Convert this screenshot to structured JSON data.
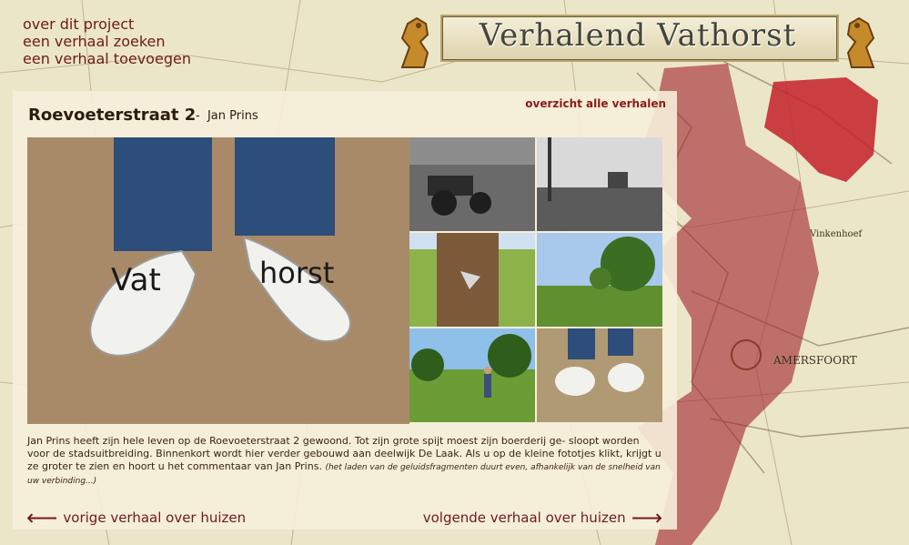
{
  "site": {
    "title": "Verhalend Vathorst"
  },
  "top_nav": [
    {
      "label": "over dit project"
    },
    {
      "label": "een verhaal zoeken"
    },
    {
      "label": "een verhaal toevoegen"
    }
  ],
  "story": {
    "title": "Roevoeterstraat 2",
    "separator": "-",
    "author": "Jan Prins",
    "overview_link": "overzicht alle verhalen",
    "description": "Jan Prins heeft zijn hele leven op de Roevoeterstraat 2 gewoond. Tot zijn grote spijt moest zijn boerderij ge- sloopt worden voor de stadsuitbreiding. Binnenkort wordt hier verder gebouwd aan deelwijk De Laak. Als u op de kleine fototjes klikt, krijgt u ze groter te zien en hoort u het commentaar van Jan Prins.",
    "note": "(het laden van de geluidsfragmenten duurt even, afhankelijk van de snelheid van uw verbinding...)"
  },
  "main_image": {
    "alt": "Wooden clogs with the words Vat horst"
  },
  "thumbnails": [
    {
      "name": "tractor-photo"
    },
    {
      "name": "farmyard-photo"
    },
    {
      "name": "tree-trunk-photo"
    },
    {
      "name": "field-trees-photo"
    },
    {
      "name": "meadow-man-photo"
    },
    {
      "name": "clogs-small-photo"
    }
  ],
  "navigation": {
    "prev": "vorige verhaal over huizen",
    "next": "volgende verhaal over huizen"
  },
  "map": {
    "labels": [
      "Vinkenhoef",
      "AMERSFOORT"
    ]
  },
  "colors": {
    "accent": "#6f1a1a",
    "panel": "#f6eeda",
    "highlight_area": "#b22234"
  }
}
